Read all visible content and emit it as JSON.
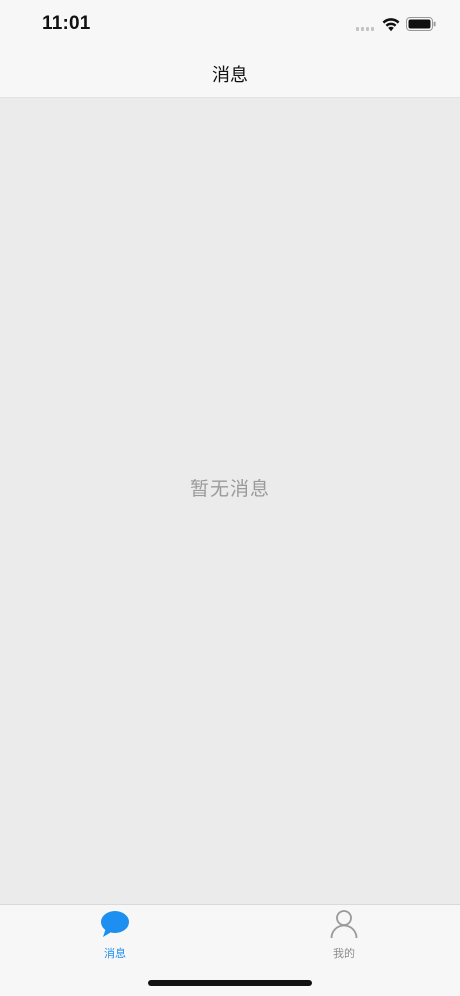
{
  "status_bar": {
    "time": "11:01",
    "signal_icon": "cellular-signal-icon",
    "wifi_icon": "wifi-icon",
    "battery_icon": "battery-icon"
  },
  "nav": {
    "title": "消息"
  },
  "content": {
    "empty_message": "暂无消息"
  },
  "tab_bar": {
    "active_color": "#1c8ff0",
    "inactive_color": "#8e8e8e",
    "tabs": [
      {
        "label": "消息",
        "icon": "chat-bubble-icon",
        "active": true
      },
      {
        "label": "我的",
        "icon": "person-icon",
        "active": false
      }
    ]
  }
}
